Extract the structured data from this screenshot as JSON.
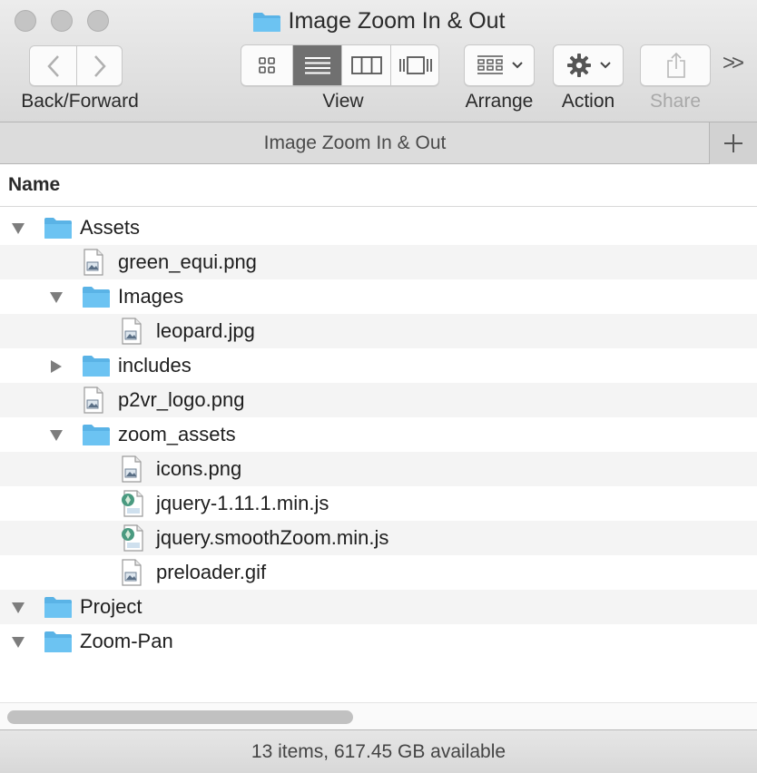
{
  "window": {
    "title": "Image Zoom In & Out",
    "folder_icon": "folder-icon"
  },
  "toolbar": {
    "back_forward_label": "Back/Forward",
    "view_label": "View",
    "view_modes": [
      "icon-view",
      "list-view",
      "column-view",
      "cover-flow-view"
    ],
    "active_view": "list-view",
    "arrange_label": "Arrange",
    "action_label": "Action",
    "share_label": "Share",
    "more_label": ">>"
  },
  "pathbar": {
    "title": "Image Zoom In & Out",
    "add_label": "+"
  },
  "column_header": {
    "name": "Name"
  },
  "files": [
    {
      "name": "Assets",
      "kind": "folder",
      "level": 0,
      "disclosure": "expanded"
    },
    {
      "name": "green_equi.png",
      "kind": "image",
      "level": 1,
      "disclosure": "none"
    },
    {
      "name": "Images",
      "kind": "folder",
      "level": 1,
      "disclosure": "expanded"
    },
    {
      "name": "leopard.jpg",
      "kind": "image",
      "level": 2,
      "disclosure": "none"
    },
    {
      "name": "includes",
      "kind": "folder",
      "level": 1,
      "disclosure": "collapsed"
    },
    {
      "name": "p2vr_logo.png",
      "kind": "image",
      "level": 1,
      "disclosure": "none"
    },
    {
      "name": "zoom_assets",
      "kind": "folder",
      "level": 1,
      "disclosure": "expanded"
    },
    {
      "name": "icons.png",
      "kind": "image",
      "level": 2,
      "disclosure": "none"
    },
    {
      "name": "jquery-1.11.1.min.js",
      "kind": "script",
      "level": 2,
      "disclosure": "none"
    },
    {
      "name": "jquery.smoothZoom.min.js",
      "kind": "script",
      "level": 2,
      "disclosure": "none"
    },
    {
      "name": "preloader.gif",
      "kind": "image",
      "level": 2,
      "disclosure": "none"
    },
    {
      "name": "Project",
      "kind": "folder",
      "level": 0,
      "disclosure": "expanded"
    },
    {
      "name": "Zoom-Pan",
      "kind": "folder",
      "level": 0,
      "disclosure": "expanded"
    }
  ],
  "status": {
    "text": "13 items, 617.45 GB available"
  },
  "colors": {
    "folder": "#6cc3f2",
    "folder_tab": "#5ab3e6",
    "active_segment": "#707070",
    "alt_row": "#f4f4f4"
  }
}
